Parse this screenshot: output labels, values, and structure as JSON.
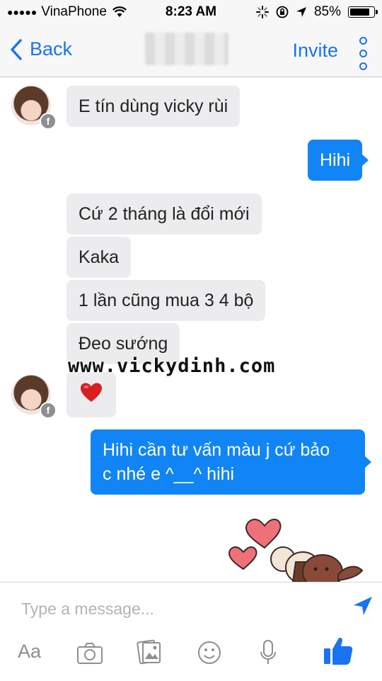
{
  "status_bar": {
    "signal": "●●●●●",
    "carrier": "VinaPhone",
    "time": "8:23 AM",
    "battery_percent": "85%",
    "battery_level": 0.85
  },
  "nav": {
    "back_label": "Back",
    "invite_label": "Invite"
  },
  "messages": {
    "m1": "E tín dùng vicky rùi",
    "m2": "Hihi",
    "m3": "Cứ 2 tháng là đổi mới",
    "m4": "Kaka",
    "m5": "1 lần cũng mua 3 4 bộ",
    "m6": "Đeo sướng",
    "m7": "❤️",
    "m8_line1": "Hihi cần tư vấn màu j cứ bảo",
    "m8_line2": "c nhé e ^__^ hihi"
  },
  "watermark": "www.vickydinh.com",
  "avatar_badge": "f",
  "composer": {
    "placeholder": "Type a message...",
    "text_format_label": "Aa"
  },
  "colors": {
    "accent": "#1a73f0",
    "outgoing_bubble": "#1185f5",
    "incoming_bubble": "#ececee"
  },
  "icons": [
    "chevron-left-icon",
    "kebab-menu-icon",
    "send-icon",
    "camera-icon",
    "gallery-icon",
    "emoji-icon",
    "microphone-icon",
    "thumbs-up-icon",
    "facebook-badge-icon",
    "wifi-icon",
    "location-arrow-icon"
  ]
}
